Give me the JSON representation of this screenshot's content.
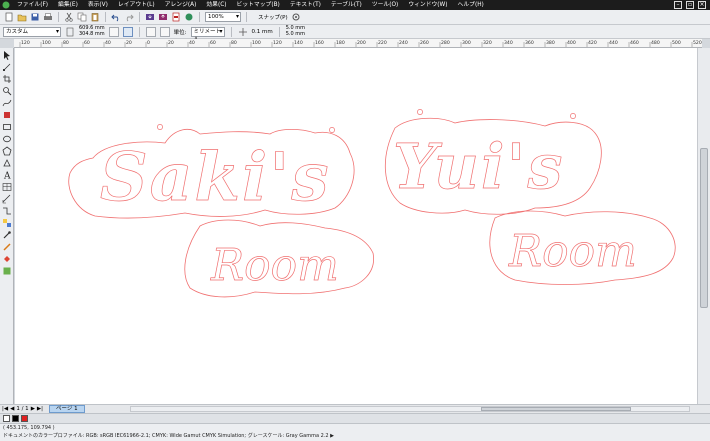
{
  "menu": [
    "ファイル(F)",
    "編集(E)",
    "表示(V)",
    "レイアウト(L)",
    "アレンジ(A)",
    "効果(C)",
    "ビットマップ(B)",
    "テキスト(T)",
    "テーブル(T)",
    "ツール(O)",
    "ウィンドウ(W)",
    "ヘルプ(H)"
  ],
  "toolbar": {
    "zoom": "100%",
    "snap_label": "スナップ(P)"
  },
  "property_bar": {
    "page_size": "カスタム",
    "width": "609.6 mm",
    "height": "304.8 mm",
    "units": "ミリメートル",
    "nudge": "0.1 mm",
    "dup_x": "5.0 mm",
    "dup_y": "5.0 mm"
  },
  "ruler_labels": [
    "120",
    "100",
    "80",
    "60",
    "40",
    "20",
    "0",
    "20",
    "40",
    "60",
    "80",
    "100",
    "120",
    "140",
    "160",
    "180",
    "200",
    "220",
    "240",
    "260",
    "280",
    "300",
    "320",
    "340",
    "360",
    "380",
    "400",
    "420",
    "440",
    "460",
    "480",
    "500",
    "520"
  ],
  "pagebar": {
    "page_counter": "1 / 1",
    "page_tab": "ページ 1"
  },
  "status": {
    "coords": "( 453.175, 109.794 )",
    "profile": "ドキュメントのカラープロファイル: RGB: sRGB IEC61966-2.1; CMYK: Wide Gamut CMYK Simulation; グレースケール: Gray Gamma 2.2 ▶"
  },
  "colors": {
    "outline": "#f07070",
    "accent": "#e02020"
  },
  "icons": [
    "new-icon",
    "open-icon",
    "save-icon",
    "print-icon",
    "undo-icon",
    "redo-icon",
    "import-icon",
    "export-icon",
    "pick-tool-icon",
    "shape-tool-icon",
    "zoom-tool-icon",
    "text-tool-icon"
  ]
}
